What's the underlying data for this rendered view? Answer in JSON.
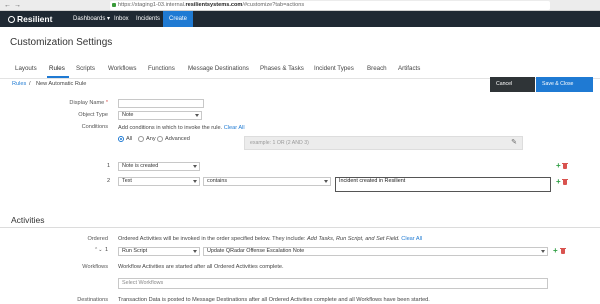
{
  "browser": {
    "back": "←",
    "forward": "→",
    "url_prefix": "https://staging1-03.internal.",
    "url_domain": "resilientsystems.com",
    "url_suffix": "/#customize?tab=actions"
  },
  "app_header": {
    "logo": "Resilient",
    "nav": [
      "Dashboards ▾",
      "Inbox",
      "Incidents"
    ],
    "create": "Create"
  },
  "page_title": "Customization Settings",
  "tabs": [
    "Layouts",
    "Rules",
    "Scripts",
    "Workflows",
    "Functions",
    "Message Destinations",
    "Phases & Tasks",
    "Incident Types",
    "Breach",
    "Artifacts"
  ],
  "breadcrumb": {
    "root": "Rules",
    "separator": "/",
    "current": "New Automatic Rule"
  },
  "actions": {
    "cancel": "Cancel",
    "save_close": "Save & Close"
  },
  "form": {
    "display_name_label": "Display Name",
    "required_mark": "*",
    "display_name_value": "",
    "object_type_label": "Object Type",
    "object_type_value": "Note",
    "conditions_label": "Conditions",
    "conditions_hint": "Add conditions in which to invoke the rule.",
    "clear_all": "Clear All",
    "match_options": [
      "All",
      "Any",
      "Advanced"
    ],
    "match_selected": "All",
    "advanced_placeholder": "example: 1 OR (2 AND 3)",
    "conditions": [
      {
        "index": "1",
        "field": "Note is created"
      },
      {
        "index": "2",
        "field": "Text",
        "operator": "contains",
        "value": "Incident created in Resilient"
      }
    ]
  },
  "activities": {
    "section_title": "Activities",
    "ordered_label": "Ordered",
    "ordered_text": "Ordered Activities will be invoked in the order specified below. They include:",
    "ordered_types": "Add Tasks, Run Script, and Set Field.",
    "clear_all": "Clear All",
    "ordered_rows": [
      {
        "index": "1",
        "arrows": "⌃⌄",
        "type": "Run Script",
        "value": "Update QRadar Offense Escalation Note"
      }
    ],
    "workflows_label": "Workflows",
    "workflows_text": "Workflow Activities are started after all Ordered Activities complete.",
    "workflows_placeholder": "Select Workflows",
    "destinations_label": "Destinations",
    "destinations_text": "Transaction Data is posted to Message Destinations after all Ordered Activities complete and all Workflows have been started."
  }
}
